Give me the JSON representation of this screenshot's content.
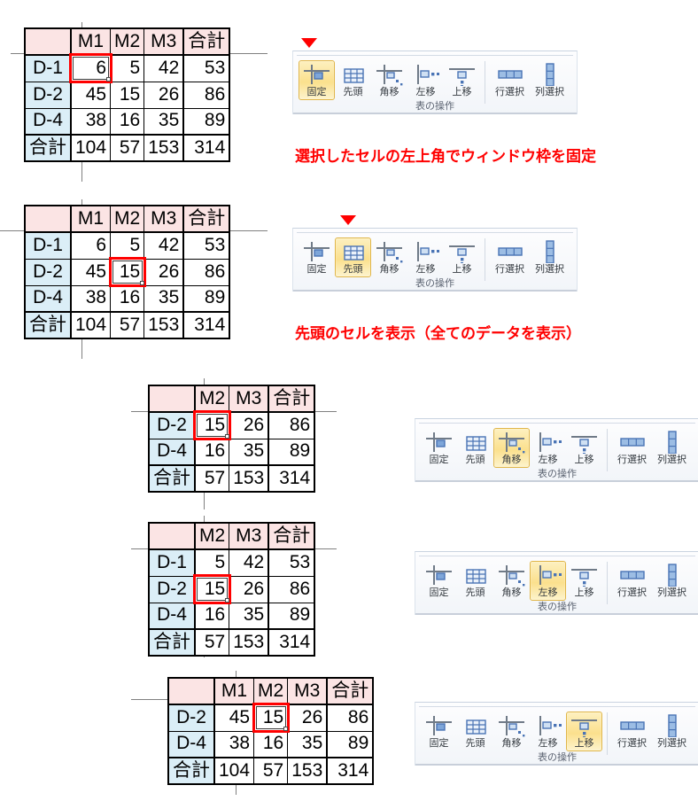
{
  "ribbon": {
    "group_label": "表の操作",
    "buttons": [
      {
        "id": "freeze",
        "label": "固定",
        "icon": "freeze-panes-icon"
      },
      {
        "id": "first-cell",
        "label": "先頭",
        "icon": "grid-table-icon"
      },
      {
        "id": "corner-move",
        "label": "角移",
        "icon": "move-corner-icon"
      },
      {
        "id": "left-move",
        "label": "左移",
        "icon": "move-left-icon"
      },
      {
        "id": "up-move",
        "label": "上移",
        "icon": "move-up-icon"
      },
      {
        "id": "select-row",
        "label": "行\n選択",
        "icon": "select-row-icon"
      },
      {
        "id": "select-col",
        "label": "列\n選択",
        "icon": "select-column-icon"
      }
    ],
    "row_label_line1": "行",
    "row_label_line2": "選択",
    "col_label_line1": "列",
    "col_label_line2": "選択"
  },
  "captions": {
    "freeze": "選択したセルの左上角でウィンドウ枠を固定",
    "first_cell": "先頭のセルを表示（全てのデータを表示）"
  },
  "colors": {
    "col_header_bg": "#fbe4e4",
    "row_header_bg": "#dbeef7",
    "selection": "#ff0000",
    "guide_line": "#808080",
    "ribbon_selected": "#fbe08d"
  },
  "tables": [
    {
      "id": "table-freeze",
      "corner": "",
      "columns": [
        "M1",
        "M2",
        "M3",
        "合計"
      ],
      "rows": [
        {
          "head": "D-1",
          "values": [
            "6",
            "5",
            "42",
            "53"
          ]
        },
        {
          "head": "D-2",
          "values": [
            "45",
            "15",
            "26",
            "86"
          ]
        },
        {
          "head": "D-4",
          "values": [
            "38",
            "16",
            "35",
            "89"
          ]
        },
        {
          "head": "合計",
          "values": [
            "104",
            "57",
            "153",
            "314"
          ],
          "total": true
        }
      ],
      "selected_cell": {
        "row": 0,
        "col": 0,
        "value": "6"
      }
    },
    {
      "id": "table-first-cell",
      "corner": "",
      "columns": [
        "M1",
        "M2",
        "M3",
        "合計"
      ],
      "rows": [
        {
          "head": "D-1",
          "values": [
            "6",
            "5",
            "42",
            "53"
          ]
        },
        {
          "head": "D-2",
          "values": [
            "45",
            "15",
            "26",
            "86"
          ]
        },
        {
          "head": "D-4",
          "values": [
            "38",
            "16",
            "35",
            "89"
          ]
        },
        {
          "head": "合計",
          "values": [
            "104",
            "57",
            "153",
            "314"
          ],
          "total": true
        }
      ],
      "selected_cell": {
        "row": 1,
        "col": 1,
        "value": "15"
      }
    },
    {
      "id": "table-corner-move",
      "corner": "",
      "columns": [
        "M2",
        "M3",
        "合計"
      ],
      "rows": [
        {
          "head": "D-2",
          "values": [
            "15",
            "26",
            "86"
          ]
        },
        {
          "head": "D-4",
          "values": [
            "16",
            "35",
            "89"
          ]
        },
        {
          "head": "合計",
          "values": [
            "57",
            "153",
            "314"
          ],
          "total": true
        }
      ],
      "selected_cell": {
        "row": 0,
        "col": 0,
        "value": "15"
      }
    },
    {
      "id": "table-left-move",
      "corner": "",
      "columns": [
        "M2",
        "M3",
        "合計"
      ],
      "rows": [
        {
          "head": "D-1",
          "values": [
            "5",
            "42",
            "53"
          ]
        },
        {
          "head": "D-2",
          "values": [
            "15",
            "26",
            "86"
          ]
        },
        {
          "head": "D-4",
          "values": [
            "16",
            "35",
            "89"
          ]
        },
        {
          "head": "合計",
          "values": [
            "57",
            "153",
            "314"
          ],
          "total": true
        }
      ],
      "selected_cell": {
        "row": 1,
        "col": 0,
        "value": "15"
      }
    },
    {
      "id": "table-up-move",
      "corner": "",
      "columns": [
        "M1",
        "M2",
        "M3",
        "合計"
      ],
      "rows": [
        {
          "head": "D-2",
          "values": [
            "45",
            "15",
            "26",
            "86"
          ]
        },
        {
          "head": "D-4",
          "values": [
            "38",
            "16",
            "35",
            "89"
          ]
        },
        {
          "head": "合計",
          "values": [
            "104",
            "57",
            "153",
            "314"
          ],
          "total": true
        }
      ],
      "selected_cell": {
        "row": 0,
        "col": 1,
        "value": "15"
      }
    }
  ],
  "ribbon_states": [
    {
      "id": "ribbon-freeze",
      "active": "固定"
    },
    {
      "id": "ribbon-first-cell",
      "active": "先頭"
    },
    {
      "id": "ribbon-corner-move",
      "active": "角移"
    },
    {
      "id": "ribbon-left-move",
      "active": "左移"
    },
    {
      "id": "ribbon-up-move",
      "active": "上移"
    }
  ]
}
